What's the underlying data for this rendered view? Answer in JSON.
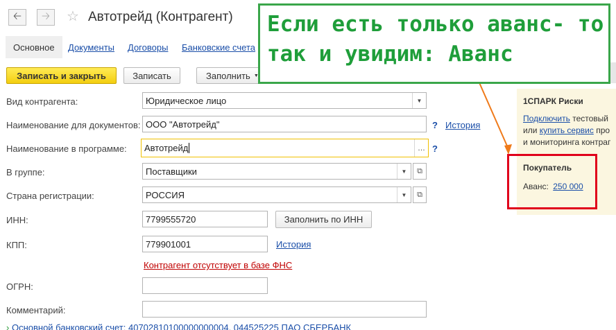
{
  "window": {
    "title": "Автотрейд (Контрагент)"
  },
  "tabs": [
    {
      "label": "Основное"
    },
    {
      "label": "Документы"
    },
    {
      "label": "Договоры"
    },
    {
      "label": "Банковские счета"
    }
  ],
  "toolbar": {
    "save_close": "Записать и закрыть",
    "save": "Записать",
    "fill": "Заполнить"
  },
  "form": {
    "kind_label": "Вид контрагента:",
    "kind_value": "Юридическое лицо",
    "doc_name_label": "Наименование для документов:",
    "doc_name_value": "ООО \"Автотрейд\"",
    "history": "История",
    "prog_name_label": "Наименование в программе:",
    "prog_name_value": "Автотрейд",
    "group_label": "В группе:",
    "group_value": "Поставщики",
    "country_label": "Страна регистрации:",
    "country_value": "РОССИЯ",
    "inn_label": "ИНН:",
    "inn_value": "7799555720",
    "fill_inn": "Заполнить по ИНН",
    "kpp_label": "КПП:",
    "kpp_value": "779901001",
    "kpp_history": "История",
    "fns_warning": "Контрагент отсутствует в базе ФНС",
    "ogrn_label": "ОГРН:",
    "ogrn_value": "",
    "comment_label": "Комментарий:",
    "comment_value": "",
    "bank_account": "Основной банковский счет: 40702810100000000004, 044525225 ПАО СБЕРБАНК"
  },
  "side": {
    "spark_title": "1СПАРК Риски",
    "connect": "Подключить",
    "text1": "тестовый",
    "or": "или",
    "buy": "купить сервис",
    "text2": "про",
    "text3": "и мониторинга контраг",
    "buyer_title": "Покупатель",
    "advance_label": "Аванс:",
    "advance_value": "250 000"
  },
  "callout": {
    "line1": "Если есть только аванс- то",
    "line2": "так и увидим: Аванс"
  },
  "colors": {
    "accent_yellow": "#f3ce10",
    "link_blue": "#1a4ea8",
    "callout_green": "#1f9e3a",
    "highlight_red": "#e0001b",
    "arrow_orange": "#ef7a1a"
  },
  "icons": {
    "back": "arrow-left-icon",
    "forward": "arrow-right-icon",
    "favorite": "star-icon",
    "dropdown": "triangle-down-icon",
    "open": "open-form-icon",
    "expand": "chevron-right-icon"
  }
}
